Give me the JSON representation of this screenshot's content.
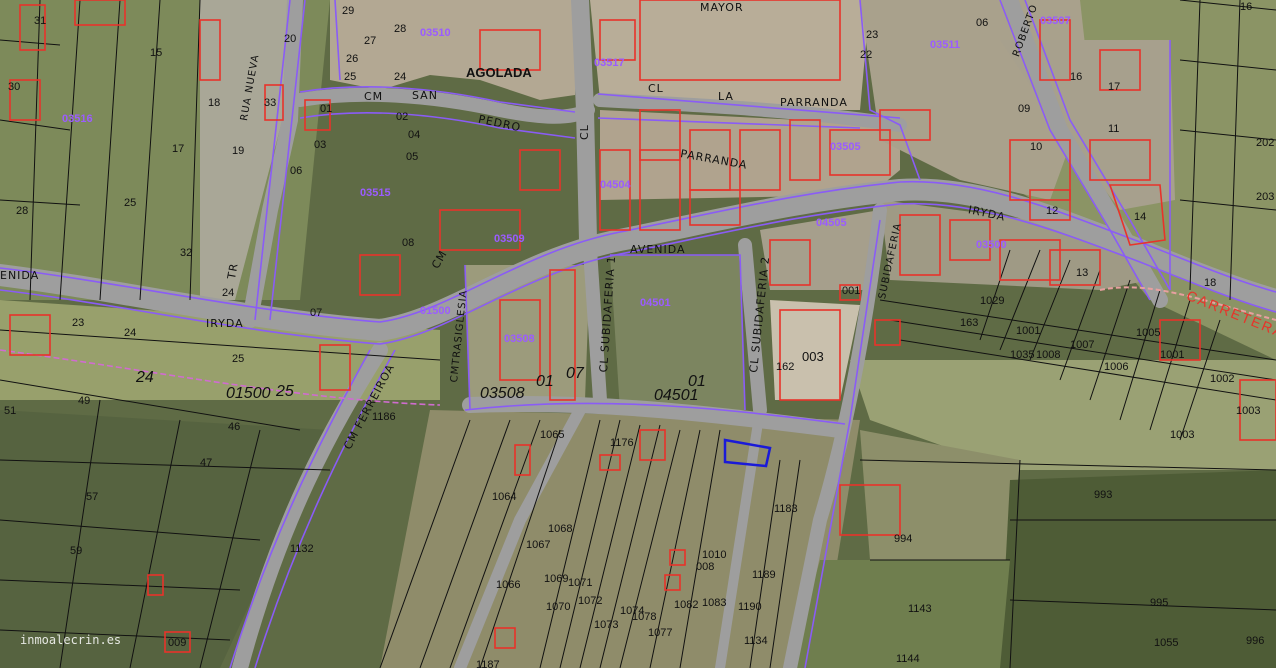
{
  "map": {
    "colors": {
      "vegetation": "#5f6b45",
      "field": "#8f9a6a",
      "road": "#a9a9a9",
      "urban": "#b5ab98",
      "cadastral_line": "#111111",
      "boundary": "#8a5cf6",
      "building": "#e8332a",
      "selected": "#1a1ad8"
    },
    "place": "AGOLADA",
    "streets": {
      "cm_san_pedro": [
        "CM",
        "SAN",
        "PEDRO"
      ],
      "cl_la_parranda": [
        "CL",
        "LA",
        "PARRANDA"
      ],
      "avenida": "AVENIDA",
      "avenida_left": "ENIDA",
      "irida_left": "IRYDA",
      "irida_right": "IRYDA",
      "rua_nueva": "RUA NUEVA",
      "tr": "TR",
      "cl_vertical": "CL",
      "cl_subidaferia1": "CL  SUBIDAFERIA 1",
      "cl_subidaferia2": "CL  SUBIDAFERIA 2",
      "subidaferia_right": "SUBIDAFERIA",
      "cm_ferreiroa": "CM FERREIROA",
      "cm_tras_iglesia": "CMTRASIGLESIA",
      "roberto": "ROBERTO",
      "mayor": "MAYOR",
      "carretera": "CARRETERA",
      "parranda_mid": "PARRANDA",
      "cm_small": "CM"
    },
    "sector_codes": [
      "03510",
      "03517",
      "03516",
      "03511",
      "03509",
      "03508",
      "04501",
      "03500",
      "03505",
      "03515",
      "04505",
      "01500",
      "03507",
      "04504"
    ],
    "big_labels": {
      "sector_left": "01500",
      "sector_left_n1": "24",
      "sector_left_n2": "25",
      "sector_mid": "03508",
      "sector_mid_n": "01",
      "sector_mid_n2": "07",
      "sector_right": "04501",
      "sector_right_n": "01"
    },
    "parcel_numbers": {
      "p1": "31",
      "p2": "29",
      "p3": "28",
      "p4": "27",
      "p5": "26",
      "p6": "25",
      "p7": "24",
      "p8": "23",
      "p9": "22",
      "p10": "20",
      "p11": "15",
      "p12": "16",
      "p13": "18",
      "p14": "19",
      "p15": "17",
      "p16": "28",
      "p17": "25",
      "p18": "32",
      "p19": "30",
      "p20": "33",
      "p21": "01",
      "p22": "02",
      "p23": "03",
      "p24": "04",
      "p25": "05",
      "p26": "06",
      "p27": "07",
      "p28": "08",
      "p29": "09",
      "p30": "10",
      "p31": "11",
      "p32": "12",
      "p33": "13",
      "p34": "14",
      "p35": "16",
      "p36": "17",
      "p37": "06",
      "p38": "1008",
      "p39": "1007",
      "p40": "1006",
      "p41": "1005",
      "p42": "1001",
      "p43": "1002",
      "p44": "1003",
      "p45": "993",
      "p46": "994",
      "p47": "995",
      "p48": "996",
      "p49": "1143",
      "p50": "1144",
      "p51": "1055",
      "p52": "1064",
      "p53": "1065",
      "p54": "1066",
      "p55": "1067",
      "p56": "1068",
      "p57": "1069",
      "p58": "1070",
      "p59": "1071",
      "p60": "1072",
      "p61": "1073",
      "p62": "1074",
      "p63": "1077",
      "p64": "1078",
      "p65": "1082",
      "p66": "1083",
      "p67": "1176",
      "p68": "1183",
      "p69": "1187",
      "p70": "1189",
      "p71": "1190",
      "p72": "1134",
      "p73": "1132",
      "p74": "51",
      "p75": "49",
      "p76": "46",
      "p77": "47",
      "p78": "57",
      "p79": "59",
      "p80": "23",
      "p81": "24",
      "p82": "25",
      "p83": "003",
      "p84": "001",
      "p85": "1001",
      "p86": "1003",
      "p87": "162",
      "p88": "163",
      "p89": "202",
      "p90": "203",
      "p91": "18",
      "p92": "1029",
      "p93": "1010",
      "p94": "008",
      "p95": "009",
      "p96": "1035",
      "p97": "1186",
      "p98": "24"
    },
    "watermark": "inmoalecrin.es"
  }
}
